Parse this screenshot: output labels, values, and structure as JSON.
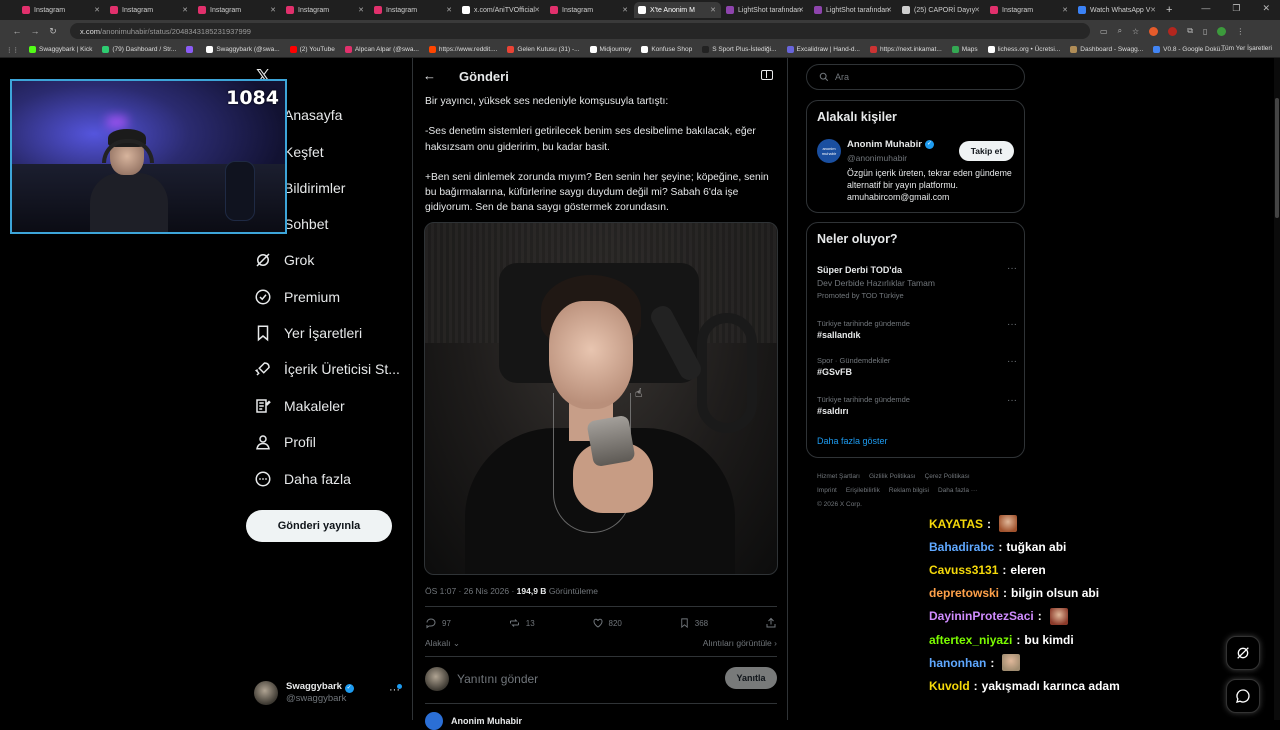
{
  "browser": {
    "tabs": [
      {
        "label": "Instagram",
        "color": "#e1306c",
        "active": false
      },
      {
        "label": "Instagram",
        "color": "#e1306c",
        "active": false
      },
      {
        "label": "Instagram",
        "color": "#e1306c",
        "active": false
      },
      {
        "label": "Instagram",
        "color": "#e1306c",
        "active": false
      },
      {
        "label": "Instagram",
        "color": "#e1306c",
        "active": false
      },
      {
        "label": "x.com/AniTVOfficial",
        "color": "#ffffff",
        "active": false
      },
      {
        "label": "Instagram",
        "color": "#e1306c",
        "active": false
      },
      {
        "label": "X'te Anonim M",
        "color": "#ffffff",
        "active": true
      },
      {
        "label": "LightShot tarafından",
        "color": "#8e44ad",
        "active": false
      },
      {
        "label": "LightShot tarafından",
        "color": "#8e44ad",
        "active": false
      },
      {
        "label": "(25) CAPORİ Dayıy",
        "color": "#cfcfcf",
        "active": false
      },
      {
        "label": "Instagram",
        "color": "#e1306c",
        "active": false
      },
      {
        "label": "Watch WhatsApp V",
        "color": "#3b82f6",
        "active": false
      }
    ],
    "url_host": "x.com",
    "url_path": "/anonimuhabir/status/2048343185231937999",
    "bookmarks": [
      {
        "label": "Swaggybark | Kick",
        "color": "#53fc18"
      },
      {
        "label": "(79) Dashboard / Str...",
        "color": "#2ecc71"
      },
      {
        "label": "",
        "color": "#8b5cf6"
      },
      {
        "label": "Swaggybark (@swa...",
        "color": "#ffffff"
      },
      {
        "label": "(2) YouTube",
        "color": "#ff0000"
      },
      {
        "label": "Alpcan Alpar (@swa...",
        "color": "#e1306c"
      },
      {
        "label": "https://www.reddit....",
        "color": "#ff4500"
      },
      {
        "label": "Gelen Kutusu (31) -...",
        "color": "#ea4335"
      },
      {
        "label": "Midjourney",
        "color": "#ffffff"
      },
      {
        "label": "Konfuse Shop",
        "color": "#ffffff"
      },
      {
        "label": "S Sport Plus-İstediği...",
        "color": "#222222"
      },
      {
        "label": "Excalidraw | Hand-d...",
        "color": "#6965db"
      },
      {
        "label": "https://next.inkamat...",
        "color": "#cc3333"
      },
      {
        "label": "Maps",
        "color": "#34a853"
      },
      {
        "label": "lichess.org • Ücretsi...",
        "color": "#ffffff"
      },
      {
        "label": "Dashboard - Swagg...",
        "color": "#b08d57"
      },
      {
        "label": "V0.8 - Google Dokü...",
        "color": "#4285f4"
      }
    ],
    "all_bookmarks": "Tüm Yer İşaretleri"
  },
  "overlay": {
    "counter": "1084"
  },
  "nav": {
    "items": [
      {
        "label": "Anasayfa",
        "icon": "home-icon"
      },
      {
        "label": "Keşfet",
        "icon": "search-icon"
      },
      {
        "label": "Bildirimler",
        "icon": "bell-icon"
      },
      {
        "label": "Sohbet",
        "icon": "chat-icon"
      },
      {
        "label": "Grok",
        "icon": "grok-icon"
      },
      {
        "label": "Premium",
        "icon": "premium-icon"
      },
      {
        "label": "Yer İşaretleri",
        "icon": "bookmark-icon"
      },
      {
        "label": "İçerik Üreticisi St...",
        "icon": "rocket-icon"
      },
      {
        "label": "Makaleler",
        "icon": "article-icon"
      },
      {
        "label": "Profil",
        "icon": "profile-icon"
      },
      {
        "label": "Daha fazla",
        "icon": "more-icon"
      }
    ],
    "post_button": "Gönderi yayınla",
    "account_name": "Swaggybark",
    "account_handle": "@swaggybark"
  },
  "post": {
    "header": "Gönderi",
    "paragraphs": [
      "Bir yayıncı, yüksek ses nedeniyle komşusuyla tartıştı:",
      "-Ses denetim sistemleri getirilecek benim ses desibelime bakılacak, eğer haksızsam onu gideririm, bu kadar basit.",
      "+Ben seni dinlemek zorunda mıyım? Ben senin her şeyine; köpeğine, senin bu bağırmalarına, küfürlerine saygı duydum değil mi? Sabah 6'da işe gidiyorum. Sen de bana saygı göstermek zorundasın."
    ],
    "time": "ÖS 1:07 · 26 Nis 2026 · ",
    "views": "194,9 B",
    "views_label": " Görüntüleme",
    "replies": "97",
    "reposts": "13",
    "likes": "820",
    "bookmarks": "368",
    "related_label": "Alakalı",
    "quotes_label": "Alıntıları görüntüle",
    "reply_placeholder": "Yanıtını gönder",
    "reply_button": "Yanıtla",
    "next_author": "Anonim Muhabir"
  },
  "sidebar": {
    "search_placeholder": "Ara",
    "related_title": "Alakalı kişiler",
    "person": {
      "name": "Anonim Muhabir",
      "handle": "@anonimuhabir",
      "avatar_text": "anonim muhabir",
      "follow": "Takip et",
      "bio": "Özgün içerik üreten, tekrar eden gündeme alternatif bir yayın platformu. amuhabircom@gmail.com"
    },
    "trends_title": "Neler oluyor?",
    "trends": [
      {
        "context": "",
        "title": "Süper Derbi TOD'da",
        "sub": "Dev Derbide Hazırlıklar Tamam",
        "promo": "Promoted by TOD Türkiye"
      },
      {
        "context": "Türkiye tarihinde gündemde",
        "title": "#sallandık",
        "sub": "",
        "promo": ""
      },
      {
        "context": "Spor · Gündemdekiler",
        "title": "#GSvFB",
        "sub": "",
        "promo": ""
      },
      {
        "context": "Türkiye tarihinde gündemde",
        "title": "#saldırı",
        "sub": "",
        "promo": ""
      }
    ],
    "show_more": "Daha fazla göster",
    "footer": [
      "Hizmet Şartları",
      "Gizlilik Politikası",
      "Çerez Politikası",
      "Imprint",
      "Erişilebilirlik",
      "Reklam bilgisi",
      "Daha fazla ···",
      "© 2026 X Corp."
    ]
  },
  "chat": {
    "messages": [
      {
        "user": "KAYATAS",
        "color": "#f5d90a",
        "text": "",
        "emote": "#a0522d"
      },
      {
        "user": "Bahadirabc",
        "color": "#5fa8ff",
        "text": "tuğkan abi",
        "emote": ""
      },
      {
        "user": "Cavuss3131",
        "color": "#f5d90a",
        "text": "eleren",
        "emote": ""
      },
      {
        "user": "depretowski",
        "color": "#ffa14a",
        "text": "bilgin olsun abi",
        "emote": ""
      },
      {
        "user": "DayininProtezSaci",
        "color": "#d08cff",
        "text": "",
        "emote": "#8b3a2a"
      },
      {
        "user": "aftertex_niyazi",
        "color": "#7cfc00",
        "text": "bu kimdi",
        "emote": ""
      },
      {
        "user": "hanonhan",
        "color": "#5fa8ff",
        "text": "",
        "emote": "#a08c70"
      },
      {
        "user": "Kuvold",
        "color": "#f5d90a",
        "text": "yakışmadı karınca adam",
        "emote": ""
      }
    ]
  }
}
